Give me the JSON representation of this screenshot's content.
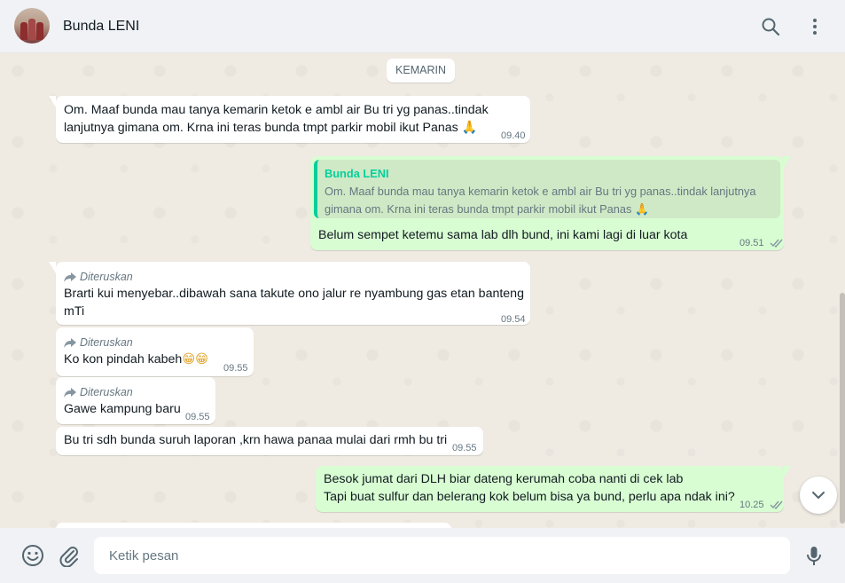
{
  "header": {
    "contact_name": "Bunda LENI",
    "icons": [
      "search-icon",
      "menu-icon"
    ]
  },
  "chat": {
    "date_label": "KEMARIN",
    "forwarded_label": "Diteruskan",
    "messages": [
      {
        "direction": "in",
        "lines": [
          "Om. Maaf bunda mau tanya kemarin ketok e ambl air Bu tri yg panas..tindak",
          "lanjutnya gimana om. Krna ini teras bunda tmpt parkir mobil ikut Panas"
        ],
        "emoji": "🙏",
        "time": "09.40"
      },
      {
        "direction": "out",
        "quote": {
          "name": "Bunda LENI",
          "lines": [
            "Om. Maaf bunda mau tanya kemarin ketok e ambl air Bu tri yg panas..tindak lanjutnya",
            "gimana om. Krna ini teras bunda tmpt parkir mobil ikut Panas"
          ],
          "emoji": "🙏"
        },
        "lines": [
          "Belum sempet ketemu sama lab dlh bund, ini kami lagi di luar kota"
        ],
        "time": "09.51"
      },
      {
        "direction": "in",
        "forwarded": true,
        "lines": [
          "Brarti kui menyebar..dibawah sana takute ono jalur re nyambung gas etan banteng",
          "mTi"
        ],
        "time": "09.54"
      },
      {
        "direction": "in",
        "forwarded": true,
        "lines": [
          "Ko kon pindah kabeh"
        ],
        "emoji": "😁😁",
        "time": "09.55"
      },
      {
        "direction": "in",
        "forwarded": true,
        "lines": [
          "Gawe kampung baru"
        ],
        "time": "09.55"
      },
      {
        "direction": "in",
        "lines": [
          "Bu tri sdh bunda suruh laporan ,krn hawa panaa mulai dari rmh bu tri"
        ],
        "time": "09.55"
      },
      {
        "direction": "out",
        "lines": [
          "Besok jumat dari DLH biar dateng kerumah coba nanti di cek lab",
          "Tapi buat sulfur dan belerang kok belum bisa ya bund, perlu apa ndak ini?"
        ],
        "time": "10.25"
      }
    ]
  },
  "footer": {
    "placeholder": "Ketik pesan",
    "icons": [
      "emoji-icon",
      "attach-icon",
      "mic-icon"
    ]
  },
  "colors": {
    "incoming_bubble": "#ffffff",
    "outgoing_bubble": "#d9fdd3",
    "quote_accent": "#06cf9c",
    "chat_background": "#efeae2"
  }
}
